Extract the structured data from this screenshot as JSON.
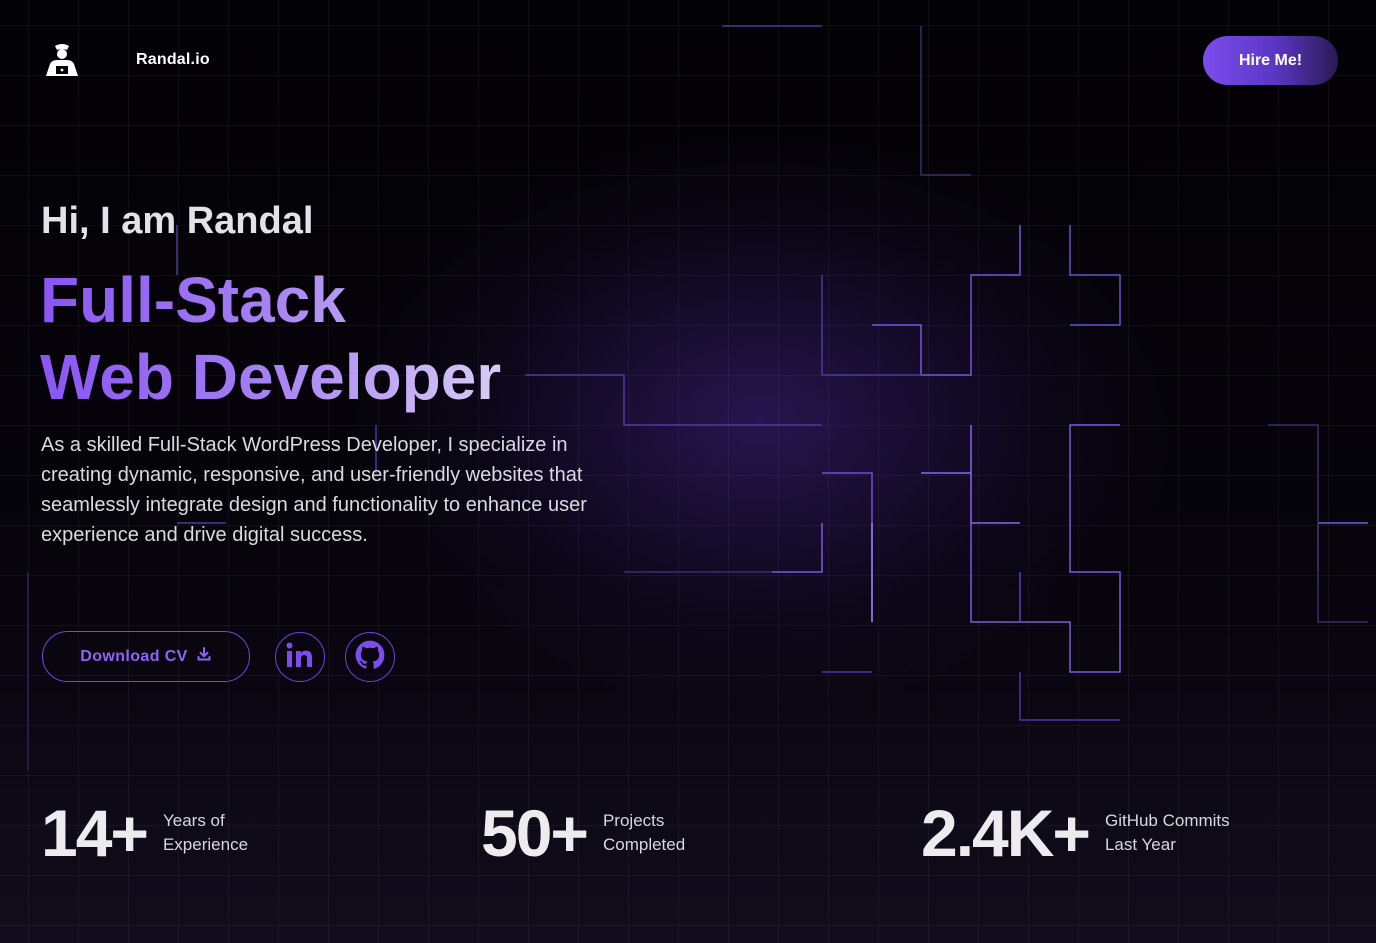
{
  "header": {
    "brand": "Randal.io",
    "hire_label": "Hire Me!"
  },
  "hero": {
    "greeting": "Hi, I am Randal",
    "headline_line1": "Full-Stack",
    "headline_line2": "Web Developer",
    "description": "As a skilled Full-Stack WordPress Developer, I specialize in creating dynamic, responsive, and user-friendly websites that seamlessly integrate design and functionality to enhance user experience and drive digital success.",
    "download_label": "Download CV"
  },
  "socials": [
    {
      "name": "LinkedIn",
      "icon": "linkedin-icon"
    },
    {
      "name": "GitHub",
      "icon": "github-icon"
    }
  ],
  "stats": [
    {
      "value": "14+",
      "label_line1": "Years of",
      "label_line2": "Experience"
    },
    {
      "value": "50+",
      "label_line1": "Projects",
      "label_line2": "Completed"
    },
    {
      "value": "2.4K+",
      "label_line1": "GitHub Commits",
      "label_line2": "Last Year"
    }
  ],
  "colors": {
    "accent": "#7c4dee",
    "accent_light": "#a27cf2",
    "background": "#050308",
    "text": "#e8e6ee"
  }
}
